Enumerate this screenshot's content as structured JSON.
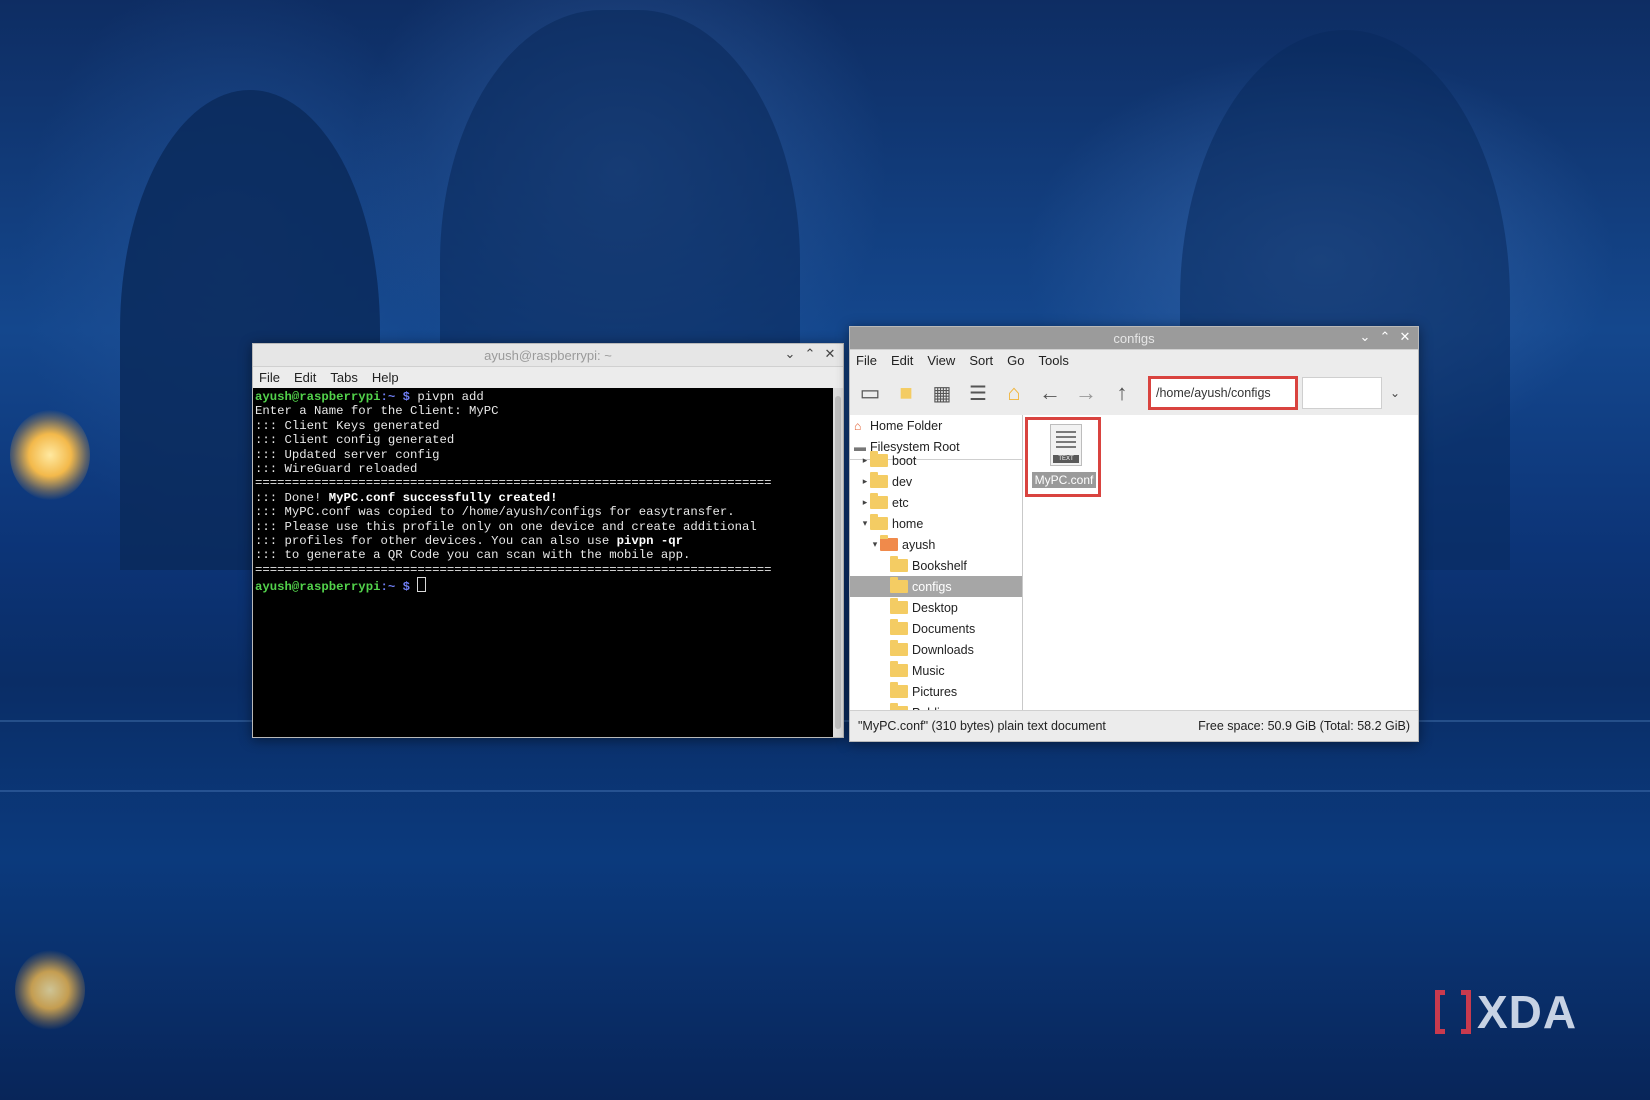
{
  "terminal": {
    "title": "ayush@raspberrypi: ~",
    "menu": [
      "File",
      "Edit",
      "Tabs",
      "Help"
    ],
    "prompt_user": "ayush@raspberrypi",
    "prompt_sep": ":~ $ ",
    "command": "pivpn add",
    "lines": [
      "Enter a Name for the Client: MyPC",
      "::: Client Keys generated",
      "::: Client config generated",
      "::: Updated server config",
      "::: WireGuard reloaded",
      "======================================================================"
    ],
    "done_prefix": "::: Done! ",
    "done_bold": "MyPC.conf successfully created!",
    "lines2": [
      "::: MyPC.conf was copied to /home/ayush/configs for easytransfer.",
      "::: Please use this profile only on one device and create additional"
    ],
    "qr_prefix": "::: profiles for other devices. You can also use ",
    "qr_bold": "pivpn -qr",
    "lines3": [
      "::: to generate a QR Code you can scan with the mobile app.",
      "======================================================================"
    ]
  },
  "file_manager": {
    "title": "configs",
    "menu": [
      "File",
      "Edit",
      "View",
      "Sort",
      "Go",
      "Tools"
    ],
    "path": "/home/ayush/configs",
    "places": [
      "Home Folder",
      "Filesystem Root"
    ],
    "tree": [
      {
        "label": "boot",
        "depth": 0,
        "arrow": "▸"
      },
      {
        "label": "dev",
        "depth": 0,
        "arrow": "▸"
      },
      {
        "label": "etc",
        "depth": 0,
        "arrow": "▸"
      },
      {
        "label": "home",
        "depth": 0,
        "arrow": "▾"
      },
      {
        "label": "ayush",
        "depth": 1,
        "arrow": "▾"
      },
      {
        "label": "Bookshelf",
        "depth": 2,
        "arrow": ""
      },
      {
        "label": "configs",
        "depth": 2,
        "arrow": "",
        "selected": true
      },
      {
        "label": "Desktop",
        "depth": 2,
        "arrow": ""
      },
      {
        "label": "Documents",
        "depth": 2,
        "arrow": ""
      },
      {
        "label": "Downloads",
        "depth": 2,
        "arrow": ""
      },
      {
        "label": "Music",
        "depth": 2,
        "arrow": ""
      },
      {
        "label": "Pictures",
        "depth": 2,
        "arrow": ""
      },
      {
        "label": "Public",
        "depth": 2,
        "arrow": ""
      }
    ],
    "file_name": "MyPC.conf",
    "file_tag": "TEXT",
    "status_left": "\"MyPC.conf\" (310 bytes) plain text document",
    "status_right": "Free space: 50.9 GiB (Total: 58.2 GiB)"
  },
  "watermark": "XDA"
}
